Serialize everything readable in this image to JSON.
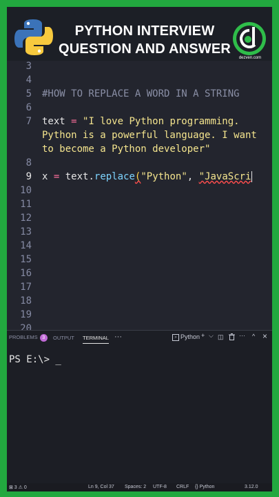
{
  "banner": {
    "title_line1": "PYTHON INTERVIEW",
    "title_line2": "QUESTION AND ANSWER",
    "brand_text": "dezven.com"
  },
  "editor": {
    "line_numbers": [
      "3",
      "4",
      "5",
      "6",
      "7",
      "8",
      "9",
      "10",
      "11",
      "12",
      "13",
      "14",
      "15",
      "16",
      "17",
      "18",
      "19",
      "20"
    ],
    "active_line": "9",
    "comment": "#HOW TO REPLACE A WORD IN A STRING",
    "text_var": "text",
    "assign": " = ",
    "text_value_line1": "\"I love Python programming.",
    "text_value_line2": "Python is a powerful language. I want",
    "text_value_line3": "to become a Python developer\"",
    "x_var": "x",
    "obj": "text.",
    "method": "replace",
    "open_paren": "(",
    "arg1": "\"Python\"",
    "comma": ", ",
    "arg2": "\"JavaScri"
  },
  "panel": {
    "tab_problems": "PROBLEMS",
    "problems_count": "3",
    "tab_output": "OUTPUT",
    "tab_terminal": "TERMINAL",
    "more": "···",
    "terminal_profile": "Python",
    "icons": {
      "plus": "+",
      "chevron": "⌵",
      "split": "◫",
      "trash": "🗑",
      "dots": "···",
      "maximize": "^",
      "close": "×"
    },
    "prompt": "PS E:\\> _"
  },
  "status": {
    "remote": "⊠ 3 ⚠ 0",
    "position": "Ln 9, Col 37",
    "spaces": "Spaces: 2",
    "encoding": "UTF-8",
    "eol": "CRLF",
    "language": "{} Python",
    "version": "3.12.0"
  },
  "colors": {
    "frame": "#22a83f",
    "banner_bg": "#1c1f26",
    "editor_bg": "#23252e",
    "string": "#f5e58e",
    "operator": "#ff6f9c",
    "function": "#7dd4ff"
  }
}
